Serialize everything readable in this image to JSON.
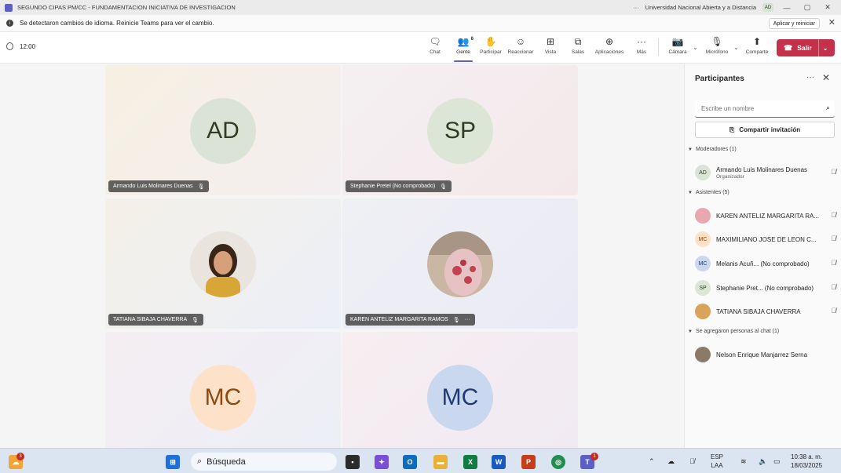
{
  "window": {
    "title": "SEGUNDO CIPAS PM/CC - FUNDAMENTACION INICIATIVA DE INVESTIGACION",
    "org": "Universidad Nacional Abierta y a Distancia",
    "user_initials": "AD",
    "more": "···",
    "minimize": "—",
    "maximize": "▢",
    "close": "✕"
  },
  "notice": {
    "text": "Se detectaron cambios de idioma. Reinicie Teams para ver el cambio.",
    "apply_label": "Aplicar y reiniciar",
    "close": "✕"
  },
  "toolbar": {
    "timer": "12:00",
    "buttons": [
      {
        "label": "Chat",
        "icon": "chat-icon",
        "glyph": "🗨"
      },
      {
        "label": "Gente",
        "icon": "people-icon",
        "glyph": "👥",
        "count": "6"
      },
      {
        "label": "Participar",
        "icon": "raise-hand-icon",
        "glyph": "✋"
      },
      {
        "label": "Reaccionar",
        "icon": "react-icon",
        "glyph": "☺"
      },
      {
        "label": "Vista",
        "icon": "view-icon",
        "glyph": "⊞"
      },
      {
        "label": "Salas",
        "icon": "rooms-icon",
        "glyph": "⧉"
      },
      {
        "label": "Aplicaciones",
        "icon": "apps-icon",
        "glyph": "⊕"
      },
      {
        "label": "Más",
        "icon": "more-icon",
        "glyph": "···"
      },
      {
        "label": "Cámara",
        "icon": "camera-off-icon",
        "glyph": "📷"
      },
      {
        "label": "Micrófono",
        "icon": "mic-off-icon",
        "glyph": "🎙"
      },
      {
        "label": "Comparte",
        "icon": "share-icon",
        "glyph": "⬆"
      }
    ],
    "leave_label": "Salir"
  },
  "tiles": [
    {
      "name": "Armando Luis Molinares Duenas",
      "initials": "AD",
      "avatar_bg": "#dbe3d6",
      "avatar_fg": "#2f3d24",
      "tile_bg": "linear-gradient(135deg,#f6f0e2,#f3eef0)"
    },
    {
      "name": "Stephanie Pretel (No comprobado)",
      "initials": "SP",
      "avatar_bg": "#dbe6d6",
      "avatar_fg": "#2f3d24",
      "tile_bg": "linear-gradient(135deg,#f4f0f2,#f4e8ea)"
    },
    {
      "name": "TATIANA SIBAJA CHAVERRA",
      "initials": "",
      "photo": "true",
      "avatar_bg": "#d9a35a",
      "avatar_fg": "#5a3a20",
      "tile_bg": "linear-gradient(135deg,#f4f0e8,#eceff7)"
    },
    {
      "name": "KAREN ANTELIZ MARGARITA RAMOS",
      "initials": "",
      "photo": "true",
      "avatar_bg": "#e8a8b0",
      "avatar_fg": "#7a2a35",
      "tile_bg": "linear-gradient(135deg,#eff0f4,#eaeaf6)",
      "more": "···"
    },
    {
      "name": "",
      "initials": "MC",
      "avatar_bg": "#fde1c8",
      "avatar_fg": "#8a4a10",
      "tile_bg": "linear-gradient(135deg,#f4eef2,#eceff6)"
    },
    {
      "name": "",
      "initials": "MC",
      "avatar_bg": "#c9d7ef",
      "avatar_fg": "#1f3b73",
      "tile_bg": "linear-gradient(135deg,#f6eef0,#f0eaf3)"
    }
  ],
  "panel": {
    "title": "Participantes",
    "more": "···",
    "close": "✕",
    "search_placeholder": "Escribe un nombre",
    "invite_label": "Compartir invitación",
    "sections": {
      "moderators": "Moderadores (1)",
      "attendees": "Asistentes (5)",
      "chat": "Se agregaron personas al chat (1)"
    },
    "moderators": [
      {
        "name": "Armando Luis Molinares Duenas",
        "sub": "Organizador",
        "initials": "AD",
        "bg": "#dbe3d6",
        "fg": "#2f3d24"
      }
    ],
    "attendees": [
      {
        "name": "KAREN ANTELIZ MARGARITA RA...",
        "initials": "",
        "bg": "#e8a8b0",
        "fg": "#7a2a35"
      },
      {
        "name": "MAXIMILIANO JOSE DE LEON C...",
        "initials": "MC",
        "bg": "#fde1c8",
        "fg": "#8a4a10"
      },
      {
        "name": "Melanis Acuñ...  (No comprobado)",
        "initials": "MC",
        "bg": "#c9d7ef",
        "fg": "#1f3b73"
      },
      {
        "name": "Stephanie Pret... (No comprobado)",
        "initials": "SP",
        "bg": "#dbe6d6",
        "fg": "#2f3d24"
      },
      {
        "name": "TATIANA SIBAJA CHAVERRA",
        "initials": "",
        "bg": "#d9a35a",
        "fg": "#5a3a20"
      }
    ],
    "chat_members": [
      {
        "name": "Nelson Enrique Manjarrez Serna",
        "initials": "",
        "bg": "#8a7a6a",
        "fg": "#fff"
      }
    ]
  },
  "taskbar": {
    "weather_badge": "3",
    "search_label": "Búsqueda",
    "teams_badge": "1",
    "lang_top": "ESP",
    "lang_bottom": "LAA",
    "time": "10:38 a. m.",
    "date": "18/03/2025"
  }
}
